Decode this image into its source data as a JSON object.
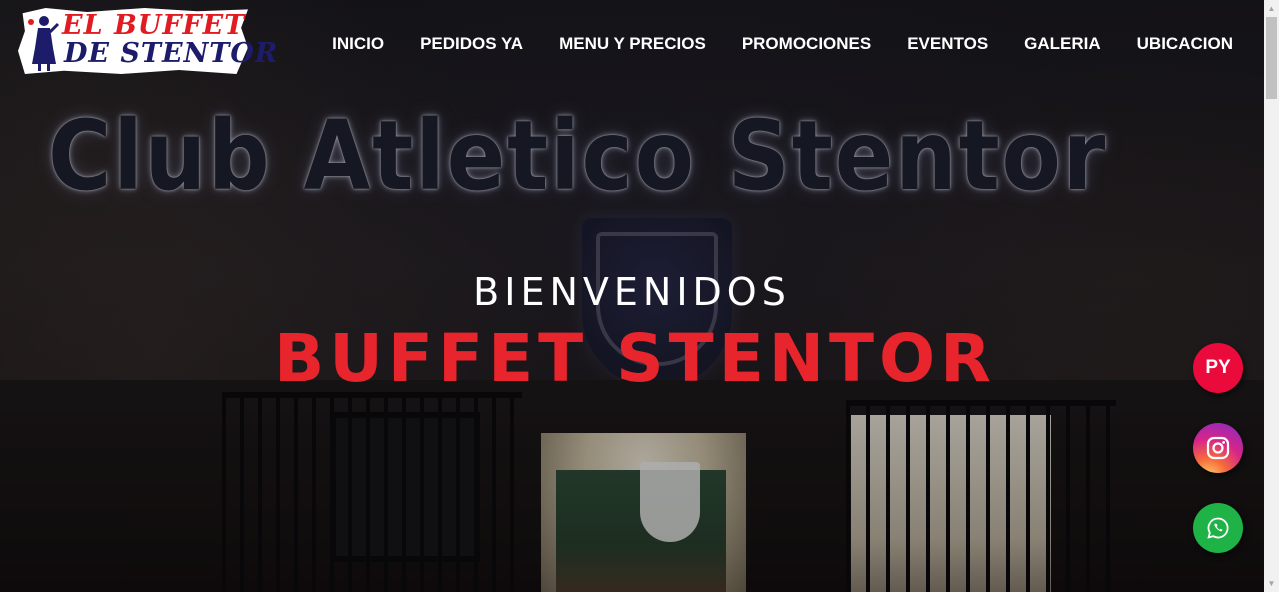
{
  "logo": {
    "line1": "EL BUFFET",
    "line2": "DE STENTOR"
  },
  "nav": {
    "items": [
      {
        "label": "INICIO"
      },
      {
        "label": "PEDIDOS YA"
      },
      {
        "label": "MENU Y PRECIOS"
      },
      {
        "label": "PROMOCIONES"
      },
      {
        "label": "EVENTOS"
      },
      {
        "label": "GALERIA"
      },
      {
        "label": "UBICACION"
      }
    ]
  },
  "hero": {
    "background_sign": "Club Atletico Stentor",
    "welcome": "BIENVENIDOS",
    "brand": "BUFFET STENTOR"
  },
  "floating_buttons": {
    "pedidosya_label": "PY",
    "instagram_icon": "instagram-icon",
    "whatsapp_icon": "whatsapp-icon"
  },
  "colors": {
    "brand_red": "#e8242c",
    "pedidosya": "#ea0a3b",
    "whatsapp": "#1fb247",
    "logo_red": "#e11b22",
    "logo_navy": "#1c1c6b"
  }
}
